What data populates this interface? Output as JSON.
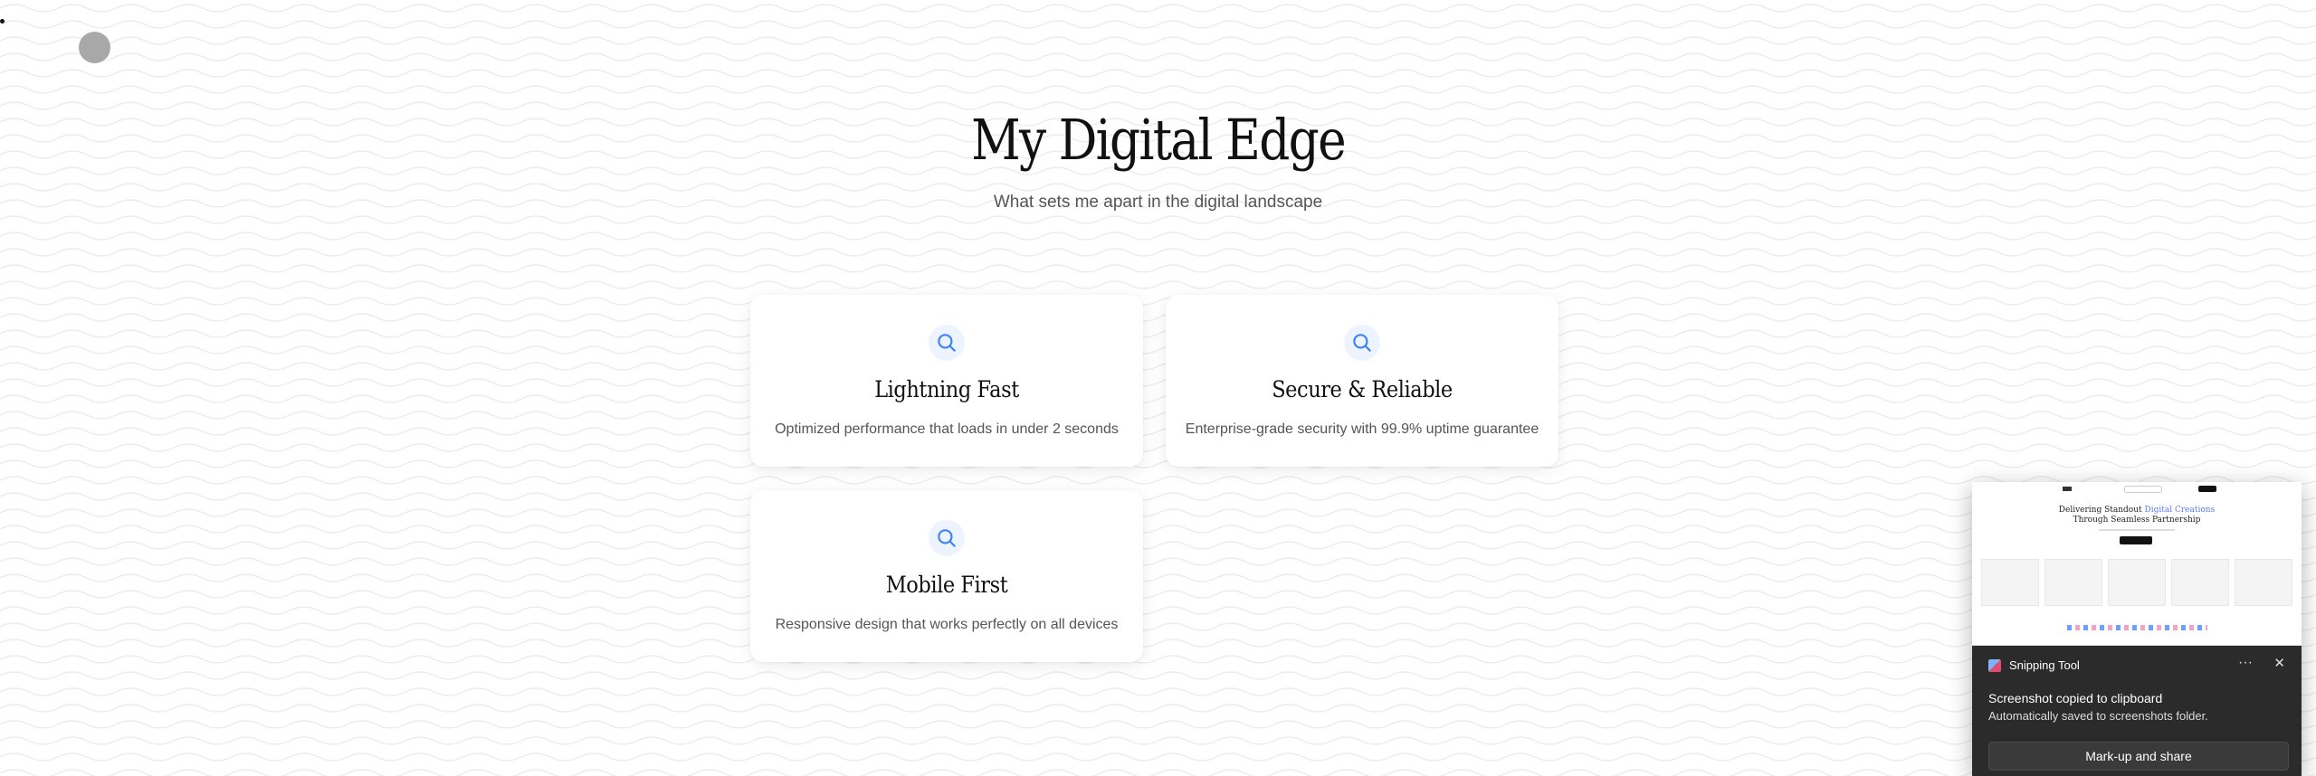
{
  "hero": {
    "title": "My Digital Edge",
    "subtitle": "What sets me apart in the digital landscape"
  },
  "cards": [
    {
      "icon": "search-icon",
      "title": "Lightning Fast",
      "description": "Optimized performance that loads in under 2 seconds"
    },
    {
      "icon": "search-icon",
      "title": "Secure & Reliable",
      "description": "Enterprise-grade security with 99.9% uptime guarantee"
    },
    {
      "icon": "search-icon",
      "title": "Mobile First",
      "description": "Responsive design that works perfectly on all devices"
    }
  ],
  "toast": {
    "app_name": "Snipping Tool",
    "title": "Screenshot copied to clipboard",
    "message": "Automatically saved to screenshots folder.",
    "action_label": "Mark-up and share",
    "more_label": "···",
    "close_label": "✕",
    "preview": {
      "headline_line1": "Delivering Standout",
      "headline_accent": "Digital Creations",
      "headline_line2": "Through Seamless Partnership"
    }
  },
  "colors": {
    "accent": "#3b82f6",
    "toast_bg": "#2b2b2b"
  }
}
